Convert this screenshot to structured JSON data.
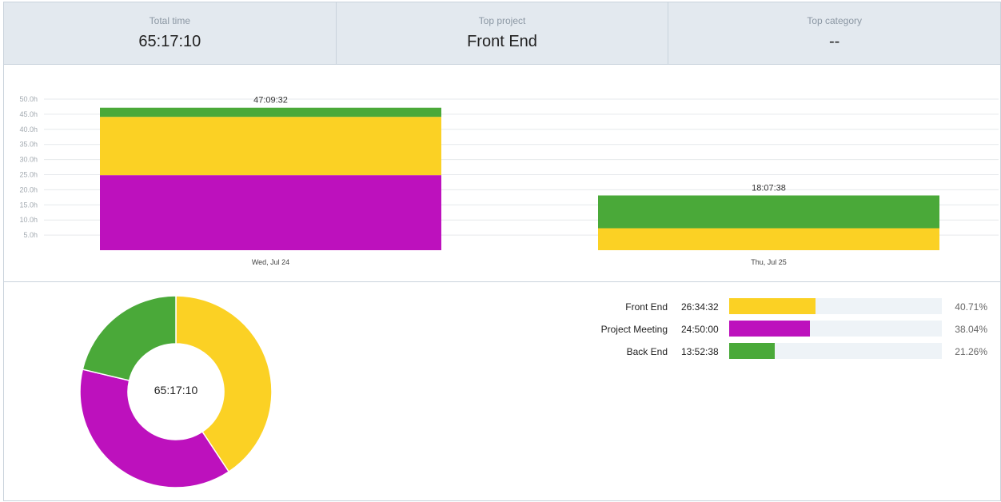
{
  "summary": {
    "total_time_label": "Total time",
    "total_time_value": "65:17:10",
    "top_project_label": "Top project",
    "top_project_value": "Front End",
    "top_category_label": "Top category",
    "top_category_value": "--"
  },
  "colors": {
    "front_end": "#fbd124",
    "project_meeting": "#bd11bd",
    "back_end": "#4aa939",
    "grid": "#e6e9ec",
    "axis_text": "#a3aab1"
  },
  "chart_data": [
    {
      "type": "bar",
      "stacked": true,
      "categories": [
        "Wed, Jul 24",
        "Thu, Jul 25"
      ],
      "totals": [
        "47:09:32",
        "18:07:38"
      ],
      "series": [
        {
          "name": "Project Meeting",
          "color": "#bd11bd",
          "values": [
            24.83,
            0
          ]
        },
        {
          "name": "Front End",
          "color": "#fbd124",
          "values": [
            19.3,
            7.27
          ]
        },
        {
          "name": "Back End",
          "color": "#4aa939",
          "values": [
            3.03,
            10.85
          ]
        }
      ],
      "ylim": [
        0,
        50
      ],
      "yticks": [
        "5.0h",
        "10.0h",
        "15.0h",
        "20.0h",
        "25.0h",
        "30.0h",
        "35.0h",
        "40.0h",
        "45.0h",
        "50.0h"
      ],
      "grid": true
    },
    {
      "type": "pie",
      "donut": true,
      "center_label": "65:17:10",
      "slices": [
        {
          "name": "Front End",
          "duration": "26:34:32",
          "value": 40.71,
          "percent": "40.71%",
          "color": "#fbd124"
        },
        {
          "name": "Project Meeting",
          "duration": "24:50:00",
          "value": 38.04,
          "percent": "38.04%",
          "color": "#bd11bd"
        },
        {
          "name": "Back End",
          "duration": "13:52:38",
          "value": 21.26,
          "percent": "21.26%",
          "color": "#4aa939"
        }
      ]
    }
  ],
  "breakdown": {
    "bar_max_percent": 100
  }
}
